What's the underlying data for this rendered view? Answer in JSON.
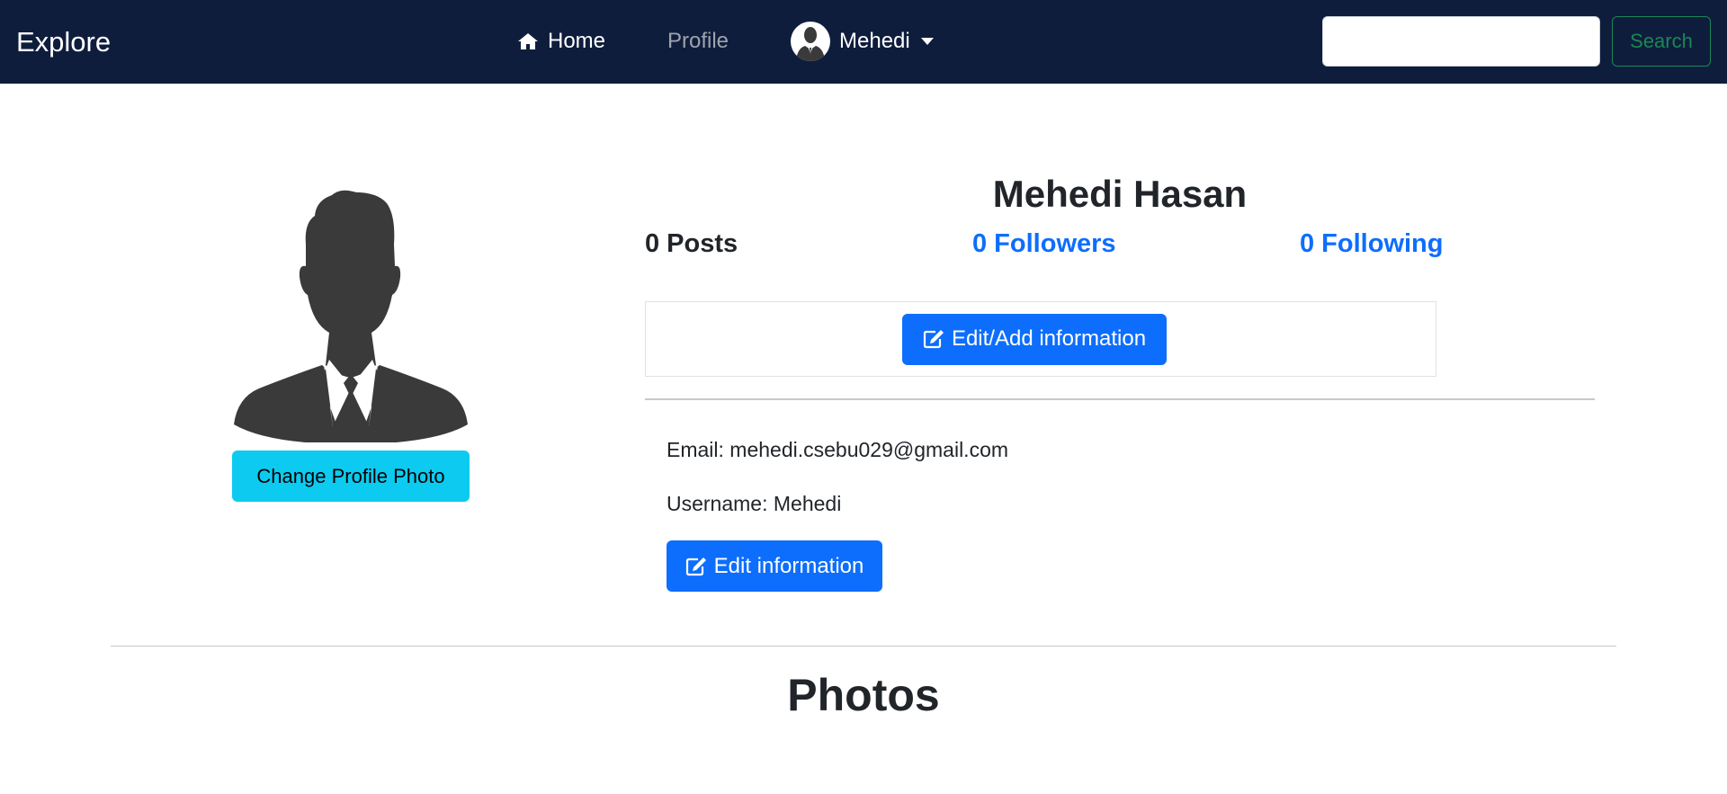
{
  "navbar": {
    "brand": "Explore",
    "home_label": "Home",
    "home_icon": "home-icon",
    "profile_label": "Profile",
    "user_label": "Mehedi",
    "search_placeholder": "",
    "search_button_label": "Search",
    "background_color": "#0f1d3d"
  },
  "profile": {
    "full_name": "Mehedi Hasan",
    "change_photo_label": "Change Profile Photo",
    "stats": {
      "posts": "0 Posts",
      "followers": "0 Followers",
      "following": "0 Following"
    },
    "edit_add_label": "Edit/Add information",
    "email_text": "Email: mehedi.csebu029@gmail.com",
    "username_text": "Username: Mehedi",
    "edit_info_label": "Edit information"
  },
  "photos": {
    "heading": "Photos"
  },
  "colors": {
    "primary": "#0d6efd",
    "info": "#0dcaf0",
    "success": "#198754"
  }
}
